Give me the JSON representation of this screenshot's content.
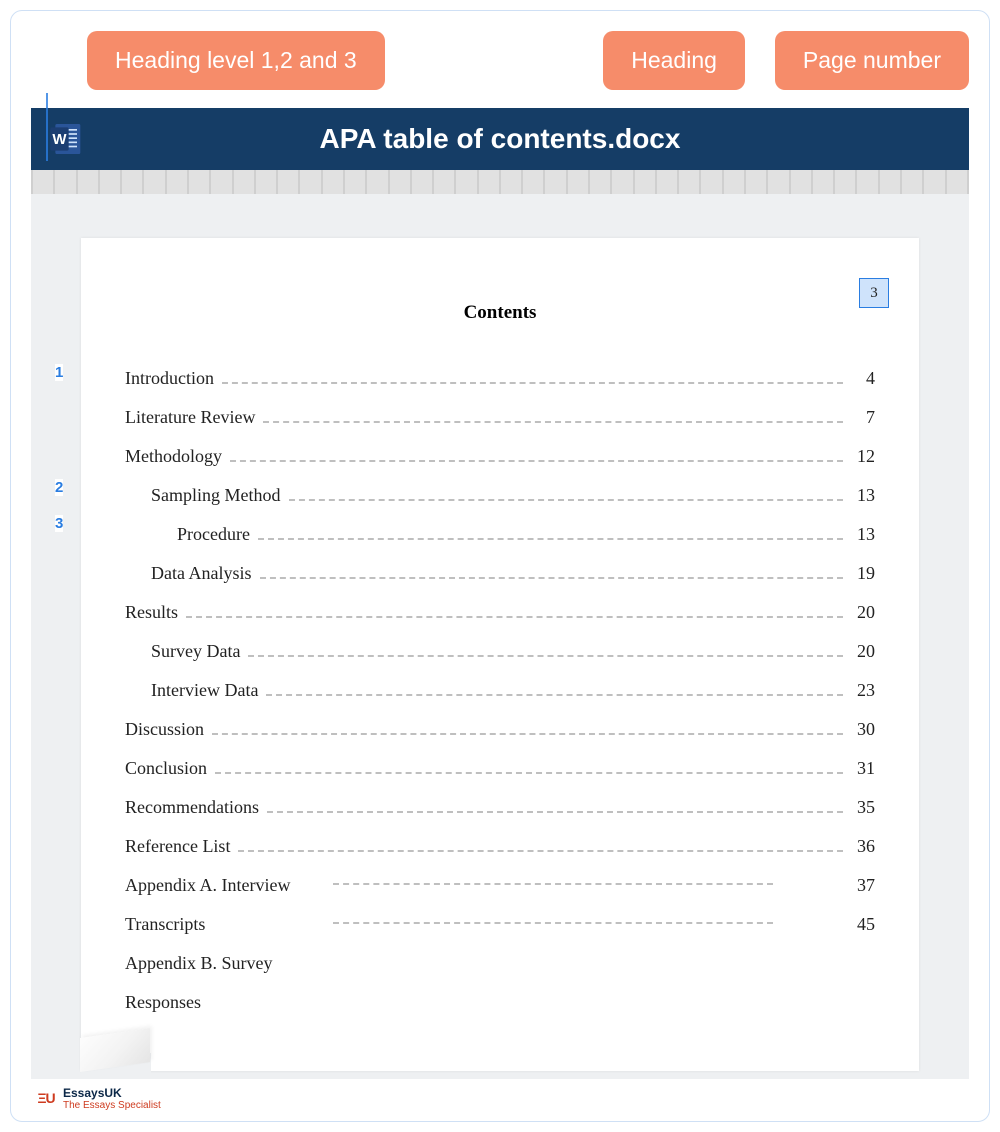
{
  "callouts": {
    "levels": "Heading level 1,2 and 3",
    "heading": "Heading",
    "pagenum": "Page number"
  },
  "titlebar": {
    "title": "APA table of contents.docx"
  },
  "doc": {
    "heading": "Contents",
    "page_number": "3"
  },
  "levels": {
    "l1": "1",
    "l2": "2",
    "l3": "3"
  },
  "toc": [
    {
      "label": "Introduction",
      "page": "4",
      "indent": 0
    },
    {
      "label": "Literature Review",
      "page": "7",
      "indent": 0
    },
    {
      "label": "Methodology",
      "page": "12",
      "indent": 0
    },
    {
      "label": "Sampling Method",
      "page": "13",
      "indent": 1
    },
    {
      "label": "Procedure",
      "page": "13",
      "indent": 2
    },
    {
      "label": "Data Analysis",
      "page": "19",
      "indent": 1
    },
    {
      "label": "Results",
      "page": "20",
      "indent": 0
    },
    {
      "label": "Survey Data",
      "page": "20",
      "indent": 1
    },
    {
      "label": "Interview Data",
      "page": "23",
      "indent": 1
    },
    {
      "label": "Discussion",
      "page": "30",
      "indent": 0
    },
    {
      "label": "Conclusion",
      "page": "31",
      "indent": 0
    },
    {
      "label": "Recommendations",
      "page": "35",
      "indent": 0
    },
    {
      "label": "Reference List",
      "page": "36",
      "indent": 0
    },
    {
      "label": "Appendix A. Interview",
      "page": "37",
      "indent": 0,
      "partial": true
    },
    {
      "label": "Transcripts",
      "page": "45",
      "indent": 0,
      "partial": true
    },
    {
      "label": "Appendix B. Survey",
      "page": "",
      "indent": 0,
      "noleader": true
    },
    {
      "label": "Responses",
      "page": "",
      "indent": 0,
      "noleader": true
    }
  ],
  "brand": {
    "mark": "ΞU",
    "line1": "EssaysUK",
    "line2": "The Essays Specialist"
  }
}
